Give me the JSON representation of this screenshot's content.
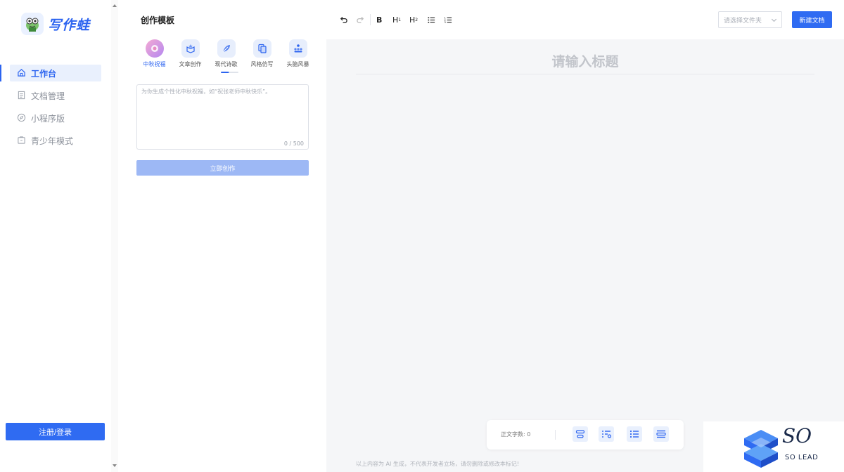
{
  "app": {
    "logo_text": "写作蛙"
  },
  "sidebar": {
    "items": [
      {
        "label": "工作台",
        "icon": "home-icon",
        "active": true
      },
      {
        "label": "文档管理",
        "icon": "document-icon",
        "active": false
      },
      {
        "label": "小程序版",
        "icon": "compass-icon",
        "active": false
      },
      {
        "label": "青少年模式",
        "icon": "shield-icon",
        "active": false
      }
    ],
    "login_label": "注册/登录"
  },
  "panel": {
    "title": "创作模板",
    "tabs": [
      {
        "label": "中秋祝福",
        "icon": "mooncake-icon",
        "active": true
      },
      {
        "label": "文章创作",
        "icon": "box-icon",
        "active": false
      },
      {
        "label": "现代诗歌",
        "icon": "feather-icon",
        "active": false
      },
      {
        "label": "风格仿写",
        "icon": "copy-icon",
        "active": false
      },
      {
        "label": "头脑风暴",
        "icon": "people-icon",
        "active": false
      }
    ],
    "prompt_placeholder": "为你生成个性化中秋祝福，如“祝张老师中秋快乐”。",
    "counter": "0 / 500",
    "create_label": "立即创作"
  },
  "toolbar": {
    "bold": "B",
    "h1": "H",
    "h1_sub": "1",
    "h2": "H",
    "h2_sub": "2",
    "folder_placeholder": "请选择文件夹",
    "new_doc_label": "新建文档"
  },
  "editor": {
    "title_placeholder": "请输入标题",
    "word_count_label": "正文字数:",
    "word_count": "0",
    "disclaimer": "以上内容为 AI 生成，不代表开发者立场，请勿删除或修改本标记!"
  },
  "watermark": {
    "brand": "SO",
    "name": "SO LEAD"
  },
  "colors": {
    "accent": "#2f6bf2",
    "accent_light": "#e9f0fd",
    "editor_bg": "#f5f6f8"
  }
}
